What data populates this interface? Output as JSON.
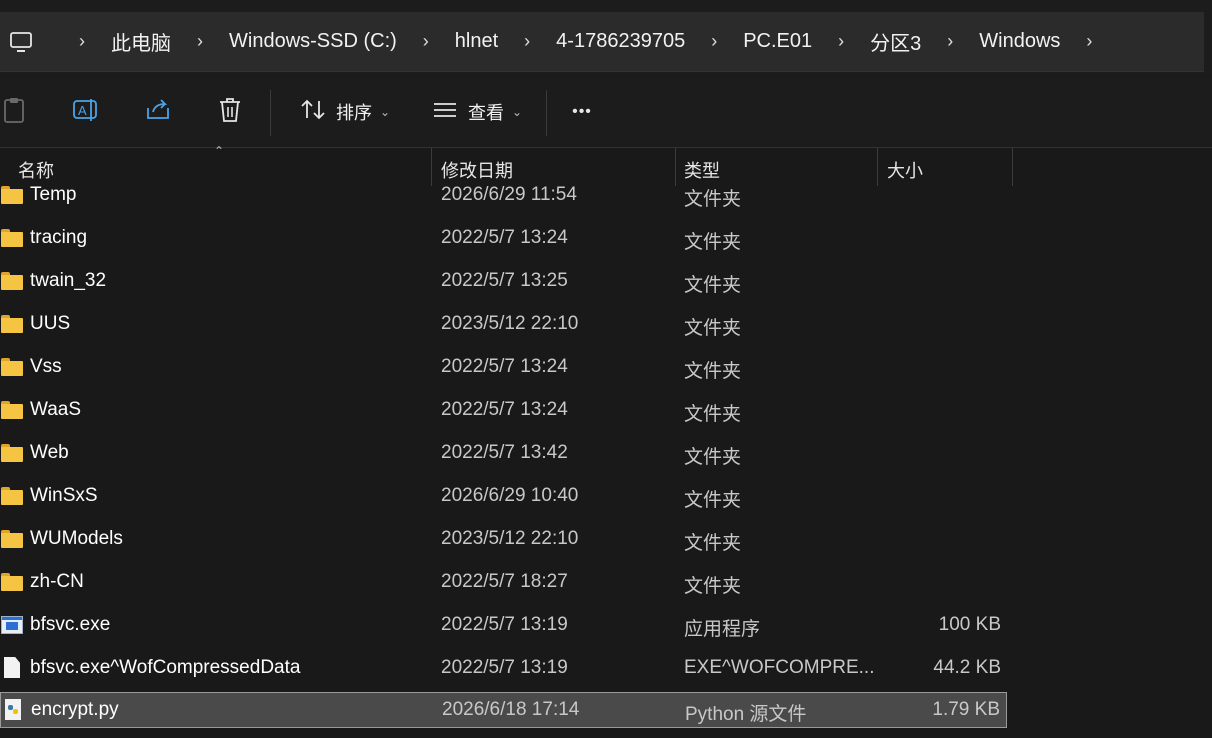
{
  "breadcrumb": [
    "此电脑",
    "Windows-SSD (C:)",
    "hlnet",
    "4-1786239705",
    "PC.E01",
    "分区3",
    "Windows"
  ],
  "toolbar": {
    "sort_label": "排序",
    "view_label": "查看",
    "more_label": "•••"
  },
  "columns": {
    "name": "名称",
    "date": "修改日期",
    "type": "类型",
    "size": "大小"
  },
  "rows": [
    {
      "icon": "folder-icon",
      "name": "Temp",
      "date": "2026/6/29 11:54",
      "type": "文件夹",
      "size": ""
    },
    {
      "icon": "folder-icon",
      "name": "tracing",
      "date": "2022/5/7 13:24",
      "type": "文件夹",
      "size": ""
    },
    {
      "icon": "folder-icon",
      "name": "twain_32",
      "date": "2022/5/7 13:25",
      "type": "文件夹",
      "size": ""
    },
    {
      "icon": "folder-icon",
      "name": "UUS",
      "date": "2023/5/12 22:10",
      "type": "文件夹",
      "size": ""
    },
    {
      "icon": "folder-icon",
      "name": "Vss",
      "date": "2022/5/7 13:24",
      "type": "文件夹",
      "size": ""
    },
    {
      "icon": "folder-icon",
      "name": "WaaS",
      "date": "2022/5/7 13:24",
      "type": "文件夹",
      "size": ""
    },
    {
      "icon": "folder-icon",
      "name": "Web",
      "date": "2022/5/7 13:42",
      "type": "文件夹",
      "size": ""
    },
    {
      "icon": "folder-icon",
      "name": "WinSxS",
      "date": "2026/6/29 10:40",
      "type": "文件夹",
      "size": ""
    },
    {
      "icon": "folder-icon",
      "name": "WUModels",
      "date": "2023/5/12 22:10",
      "type": "文件夹",
      "size": ""
    },
    {
      "icon": "folder-icon",
      "name": "zh-CN",
      "date": "2022/5/7 18:27",
      "type": "文件夹",
      "size": ""
    },
    {
      "icon": "exe-icon",
      "name": "bfsvc.exe",
      "date": "2022/5/7 13:19",
      "type": "应用程序",
      "size": "100 KB"
    },
    {
      "icon": "file-icon",
      "name": "bfsvc.exe^WofCompressedData",
      "date": "2022/5/7 13:19",
      "type": "EXE^WOFCOMPRE...",
      "size": "44.2 KB"
    },
    {
      "icon": "python-file-icon",
      "name": "encrypt.py",
      "date": "2026/6/18 17:14",
      "type": "Python 源文件",
      "size": "1.79 KB",
      "selected": true
    }
  ]
}
